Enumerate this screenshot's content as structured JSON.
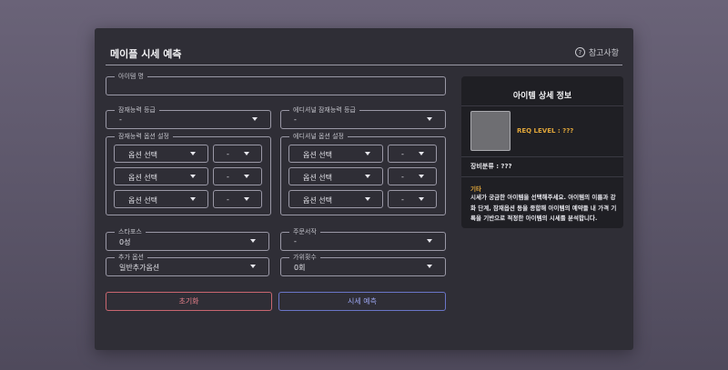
{
  "header": {
    "title": "메이플 시세 예측",
    "reference_label": "참고사항",
    "reference_icon": "question-circle-icon"
  },
  "form": {
    "item_name": {
      "label": "아이템 명",
      "placeholder": "",
      "value": ""
    },
    "potential_grade": {
      "label": "잠재능력 등급",
      "value": "-"
    },
    "additional_potential_grade": {
      "label": "에디셔널 잠재능력 등급",
      "value": "-"
    },
    "potential_options": {
      "label": "잠재능력 옵션 설정",
      "rows": [
        {
          "option": "옵션 선택",
          "value": "-"
        },
        {
          "option": "옵션 선택",
          "value": "-"
        },
        {
          "option": "옵션 선택",
          "value": "-"
        }
      ]
    },
    "additional_options": {
      "label": "에디셔널 옵션 설정",
      "rows": [
        {
          "option": "옵션 선택",
          "value": "-"
        },
        {
          "option": "옵션 선택",
          "value": "-"
        },
        {
          "option": "옵션 선택",
          "value": "-"
        }
      ]
    },
    "starforce": {
      "label": "스타포스",
      "value": "0성"
    },
    "scroll": {
      "label": "주문서작",
      "value": "-"
    },
    "extra_option": {
      "label": "추가 옵션",
      "value": "일반추가옵션"
    },
    "scissors": {
      "label": "가위횟수",
      "value": "0회"
    }
  },
  "buttons": {
    "reset": "초기화",
    "predict": "시세 예측"
  },
  "detail": {
    "title": "아이템 상세 정보",
    "req_level": "REQ LEVEL : ???",
    "category": "장비분류 : ???",
    "etc_label": "기타",
    "etc_text": "시세가 궁금한 아이템을 선택해주세요. 아이템의 이름과 강화 단계, 잠재옵션 등을 종합해 아이템의 예약들 내 가격 기록을 기반으로 적정한 아이템의 시세를 분석합니다."
  },
  "colors": {
    "accent_gold": "#e0a63a",
    "reset_red": "#e7808a",
    "predict_blue": "#9aa4ee"
  }
}
